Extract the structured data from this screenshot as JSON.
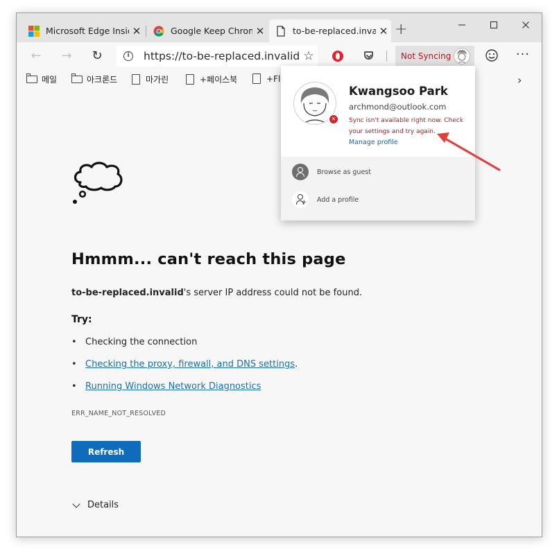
{
  "tabs": [
    {
      "title": "Microsoft Edge Insider",
      "close": "✕"
    },
    {
      "title": "Google Keep Chrome Extension",
      "close": "✕"
    },
    {
      "title": "to-be-replaced.invalid",
      "close": "✕"
    }
  ],
  "new_tab": "+",
  "window_controls": {
    "minimize": "—",
    "maximize": "☐",
    "close": "✕"
  },
  "toolbar": {
    "back": "←",
    "forward": "→",
    "refresh": "↻",
    "url": "https://to-be-replaced.invalid/",
    "favorite": "☆",
    "more": "···"
  },
  "profile_button": {
    "label": "Not Syncing"
  },
  "favorites": [
    {
      "label": "메일",
      "icon": "folder-icon"
    },
    {
      "label": "아크론드",
      "icon": "folder-icon"
    },
    {
      "label": "마가린",
      "icon": "page-icon"
    },
    {
      "label": "+페이스북",
      "icon": "page-icon"
    },
    {
      "label": "+Fl",
      "icon": "page-icon"
    }
  ],
  "favorites_overflow": "›",
  "error_page": {
    "title": "Hmmm... can't reach this page",
    "host": "to-be-replaced.invalid",
    "desc_suffix": "'s server IP address could not be found.",
    "try_label": "Try:",
    "suggestions": [
      {
        "text": "Checking the connection",
        "link": false
      },
      {
        "text": "Checking the proxy, firewall, and DNS settings",
        "link": true,
        "after": "."
      },
      {
        "text": "Running Windows Network Diagnostics",
        "link": true
      }
    ],
    "error_code": "ERR_NAME_NOT_RESOLVED",
    "refresh_label": "Refresh",
    "details_label": "Details"
  },
  "profile_flyout": {
    "name": "Kwangsoo Park",
    "email": "archmond@outlook.com",
    "warning": "Sync isn't available right now. Check your settings and try again.",
    "manage": "Manage profile",
    "badge": "✕",
    "browse_guest": "Browse as guest",
    "add_profile": "Add a profile"
  },
  "colors": {
    "accent": "#0f6cbd",
    "error_red": "#c4141f",
    "link": "#1a6fb4",
    "annotation_arrow": "#e0413e"
  }
}
